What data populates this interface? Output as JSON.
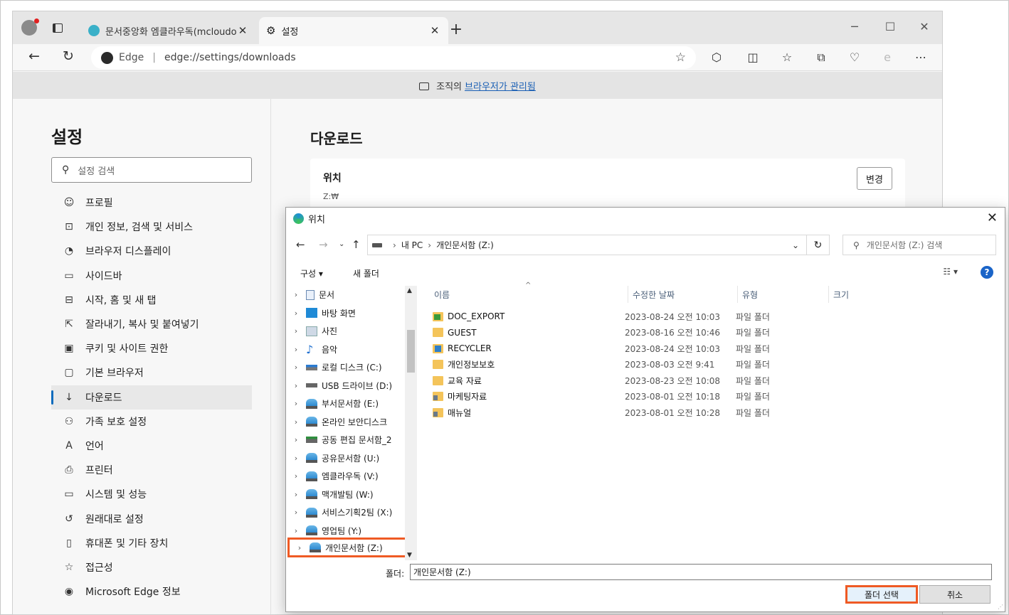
{
  "browser": {
    "tabs": [
      {
        "title": "문서중앙화 엠클라우독(mcloudo",
        "icon": "mcloudoc-icon"
      },
      {
        "title": "설정",
        "icon": "gear-icon"
      }
    ],
    "address": {
      "brand": "Edge",
      "url": "edge://settings/downloads"
    },
    "managed_text": "조직의",
    "managed_link": "브라우저가 관리됨"
  },
  "settings": {
    "title": "설정",
    "search_placeholder": "설정 검색",
    "nav": [
      {
        "label": "프로필",
        "icon": "profile-icon"
      },
      {
        "label": "개인 정보, 검색 및 서비스",
        "icon": "lock-icon"
      },
      {
        "label": "브라우저 디스플레이",
        "icon": "palette-icon"
      },
      {
        "label": "사이드바",
        "icon": "sidebar-icon"
      },
      {
        "label": "시작, 홈 및 새 탭",
        "icon": "home-icon"
      },
      {
        "label": "잘라내기, 복사 및 붙여넣기",
        "icon": "share-icon"
      },
      {
        "label": "쿠키 및 사이트 권한",
        "icon": "cookie-icon"
      },
      {
        "label": "기본 브라우저",
        "icon": "browser-icon"
      },
      {
        "label": "다운로드",
        "icon": "download-icon",
        "selected": true
      },
      {
        "label": "가족 보호 설정",
        "icon": "family-icon"
      },
      {
        "label": "언어",
        "icon": "language-icon"
      },
      {
        "label": "프린터",
        "icon": "printer-icon"
      },
      {
        "label": "시스템 및 성능",
        "icon": "system-icon"
      },
      {
        "label": "원래대로 설정",
        "icon": "reset-icon"
      },
      {
        "label": "휴대폰 및 기타 장치",
        "icon": "phone-icon"
      },
      {
        "label": "접근성",
        "icon": "accessibility-icon"
      },
      {
        "label": "Microsoft Edge 정보",
        "icon": "edge-icon"
      }
    ],
    "section_title": "다운로드",
    "location_label": "위치",
    "location_value": "Z:₩",
    "change_button": "변경"
  },
  "dialog": {
    "title": "위치",
    "breadcrumb": [
      "내 PC",
      "개인문서함 (Z:)"
    ],
    "search_placeholder": "개인문서함 (Z:) 검색",
    "organize": "구성 ▾",
    "new_folder": "새 폴더",
    "tree": [
      {
        "label": "문서",
        "icon": "doc"
      },
      {
        "label": "바탕 화면",
        "icon": "desk"
      },
      {
        "label": "사진",
        "icon": "pic"
      },
      {
        "label": "음악",
        "icon": "music"
      },
      {
        "label": "로컬 디스크 (C:)",
        "icon": "local"
      },
      {
        "label": "USB 드라이브 (D:)",
        "icon": "usb"
      },
      {
        "label": "부서문서함 (E:)",
        "icon": "net"
      },
      {
        "label": "온라인 보안디스크",
        "icon": "net"
      },
      {
        "label": "공동 편집 문서함_2",
        "icon": "share"
      },
      {
        "label": "공유문서함 (U:)",
        "icon": "net"
      },
      {
        "label": "엠클라우독 (V:)",
        "icon": "net"
      },
      {
        "label": "맥개발팀 (W:)",
        "icon": "net"
      },
      {
        "label": "서비스기획2팀 (X:)",
        "icon": "net"
      },
      {
        "label": "영업팀 (Y:)",
        "icon": "net"
      },
      {
        "label": "개인문서함 (Z:)",
        "icon": "net",
        "highlight": true
      }
    ],
    "columns": [
      "이름",
      "수정한 날짜",
      "유형",
      "크기"
    ],
    "files": [
      {
        "name": "DOC_EXPORT",
        "date": "2023-08-24 오전 10:03",
        "type": "파일 폴더",
        "icon": "green"
      },
      {
        "name": "GUEST",
        "date": "2023-08-16 오전 10:46",
        "type": "파일 폴더",
        "icon": ""
      },
      {
        "name": "RECYCLER",
        "date": "2023-08-24 오전 10:03",
        "type": "파일 폴더",
        "icon": "blue"
      },
      {
        "name": "개인정보보호",
        "date": "2023-08-03 오전 9:41",
        "type": "파일 폴더",
        "icon": ""
      },
      {
        "name": "교육 자료",
        "date": "2023-08-23 오전 10:08",
        "type": "파일 폴더",
        "icon": ""
      },
      {
        "name": "마케팅자료",
        "date": "2023-08-01 오전 10:18",
        "type": "파일 폴더",
        "icon": "gray"
      },
      {
        "name": "매뉴얼",
        "date": "2023-08-01 오전 10:28",
        "type": "파일 폴더",
        "icon": "gray"
      }
    ],
    "folder_label": "폴더:",
    "folder_value": "개인문서함 (Z:)",
    "select_button": "폴더 선택",
    "cancel_button": "취소"
  },
  "colors": {
    "accent": "#0f6cbd",
    "highlight": "#ef5a24",
    "link": "#1a5fb4"
  }
}
